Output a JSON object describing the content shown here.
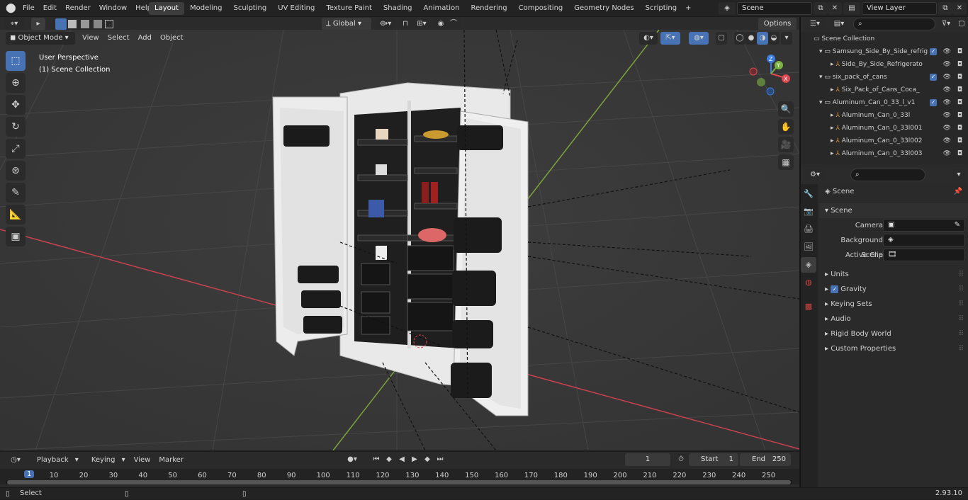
{
  "app": {
    "logo": "blender-icon"
  },
  "menu": [
    "File",
    "Edit",
    "Render",
    "Window",
    "Help"
  ],
  "workspaces": [
    {
      "label": "Layout",
      "active": true
    },
    {
      "label": "Modeling"
    },
    {
      "label": "Sculpting"
    },
    {
      "label": "UV Editing"
    },
    {
      "label": "Texture Paint"
    },
    {
      "label": "Shading"
    },
    {
      "label": "Animation"
    },
    {
      "label": "Rendering"
    },
    {
      "label": "Compositing"
    },
    {
      "label": "Geometry Nodes"
    },
    {
      "label": "Scripting"
    }
  ],
  "scene_field": "Scene",
  "view_layer_field": "View Layer",
  "viewport": {
    "mode": "Object Mode",
    "menus": [
      "View",
      "Select",
      "Add",
      "Object"
    ],
    "transform_orientation": "Global",
    "options_label": "Options",
    "overlay_title": "User Perspective",
    "overlay_subtitle": "(1) Scene Collection",
    "gizmo": {
      "x": "X",
      "y": "Y",
      "z": "Z"
    }
  },
  "outliner": {
    "root": "Scene Collection",
    "rows": [
      {
        "label": "Samsung_Side_By_Side_refrig",
        "indent": 1,
        "type": "collection",
        "checked": true
      },
      {
        "label": "Side_By_Side_Refrigerato",
        "indent": 2,
        "type": "object"
      },
      {
        "label": "six_pack_of_cans",
        "indent": 1,
        "type": "collection",
        "checked": true
      },
      {
        "label": "Six_Pack_of_Cans_Coca_",
        "indent": 2,
        "type": "object"
      },
      {
        "label": "Aluminum_Can_0_33_l_v1",
        "indent": 1,
        "type": "collection",
        "checked": true
      },
      {
        "label": "Aluminum_Can_0_33l",
        "indent": 2,
        "type": "object"
      },
      {
        "label": "Aluminum_Can_0_33l001",
        "indent": 2,
        "type": "object"
      },
      {
        "label": "Aluminum_Can_0_33l002",
        "indent": 2,
        "type": "object"
      },
      {
        "label": "Aluminum_Can_0_33l003",
        "indent": 2,
        "type": "object"
      }
    ]
  },
  "properties": {
    "context": "Scene",
    "panel": "Scene",
    "fields": [
      {
        "label": "Camera"
      },
      {
        "label": "Background Scene"
      },
      {
        "label": "Active Clip"
      }
    ],
    "sections": [
      {
        "label": "Units"
      },
      {
        "label": "Gravity",
        "checkbox": true
      },
      {
        "label": "Keying Sets"
      },
      {
        "label": "Audio"
      },
      {
        "label": "Rigid Body World"
      },
      {
        "label": "Custom Properties"
      }
    ]
  },
  "timeline": {
    "menus": [
      "Playback",
      "Keying",
      "View",
      "Marker"
    ],
    "current_frame": "1",
    "start_label": "Start",
    "start": "1",
    "end_label": "End",
    "end": "250",
    "ticks": [
      "1",
      "10",
      "20",
      "30",
      "40",
      "50",
      "60",
      "70",
      "80",
      "90",
      "100",
      "110",
      "120",
      "130",
      "140",
      "150",
      "160",
      "170",
      "180",
      "190",
      "200",
      "210",
      "220",
      "230",
      "240",
      "250"
    ]
  },
  "status": {
    "left": "Select",
    "version": "2.93.10"
  },
  "colors": {
    "accent": "#4772b3",
    "grid_x": "#c8424d",
    "grid_y": "#7aa43b"
  }
}
